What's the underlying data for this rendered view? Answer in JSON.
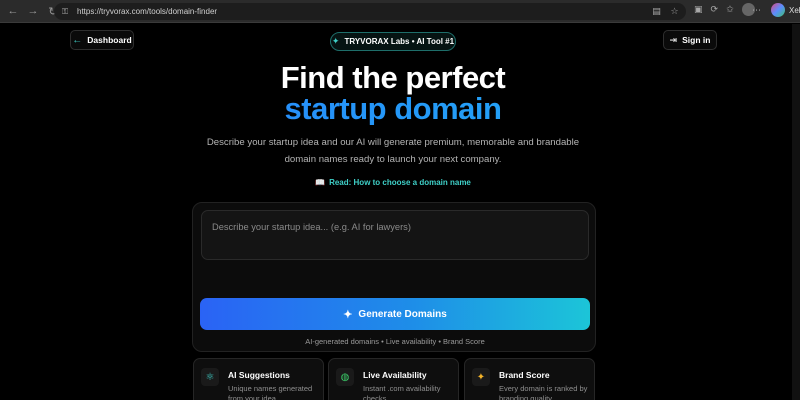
{
  "browser": {
    "url": "https://tryvorax.com/tools/domain-finder",
    "profile_name": "Xel"
  },
  "header": {
    "dashboard_label": "Dashboard",
    "badge_label": "TRYVORAX Labs • AI Tool #1",
    "signin_label": "Sign in"
  },
  "hero": {
    "title_line1": "Find the perfect",
    "title_line2": "startup domain",
    "desc_line1": "Describe your startup idea and our AI will generate premium, memorable and brandable",
    "desc_line2": "domain names ready to launch your next company.",
    "read_link": "Read: How to choose a domain name"
  },
  "form": {
    "placeholder": "Describe your startup idea... (e.g. AI for lawyers)",
    "generate_label": "Generate Domains",
    "footnote": "AI-generated domains • Live availability • Brand Score"
  },
  "features": [
    {
      "title": "AI Suggestions",
      "text": "Unique names generated from your idea."
    },
    {
      "title": "Live Availability",
      "text": "Instant .com availability checks."
    },
    {
      "title": "Brand Score",
      "text": "Every domain is ranked by branding quality."
    }
  ],
  "colors": {
    "accent_teal": "#3fd0c8",
    "accent_blue": "#1a8fff",
    "background": "#000000"
  }
}
